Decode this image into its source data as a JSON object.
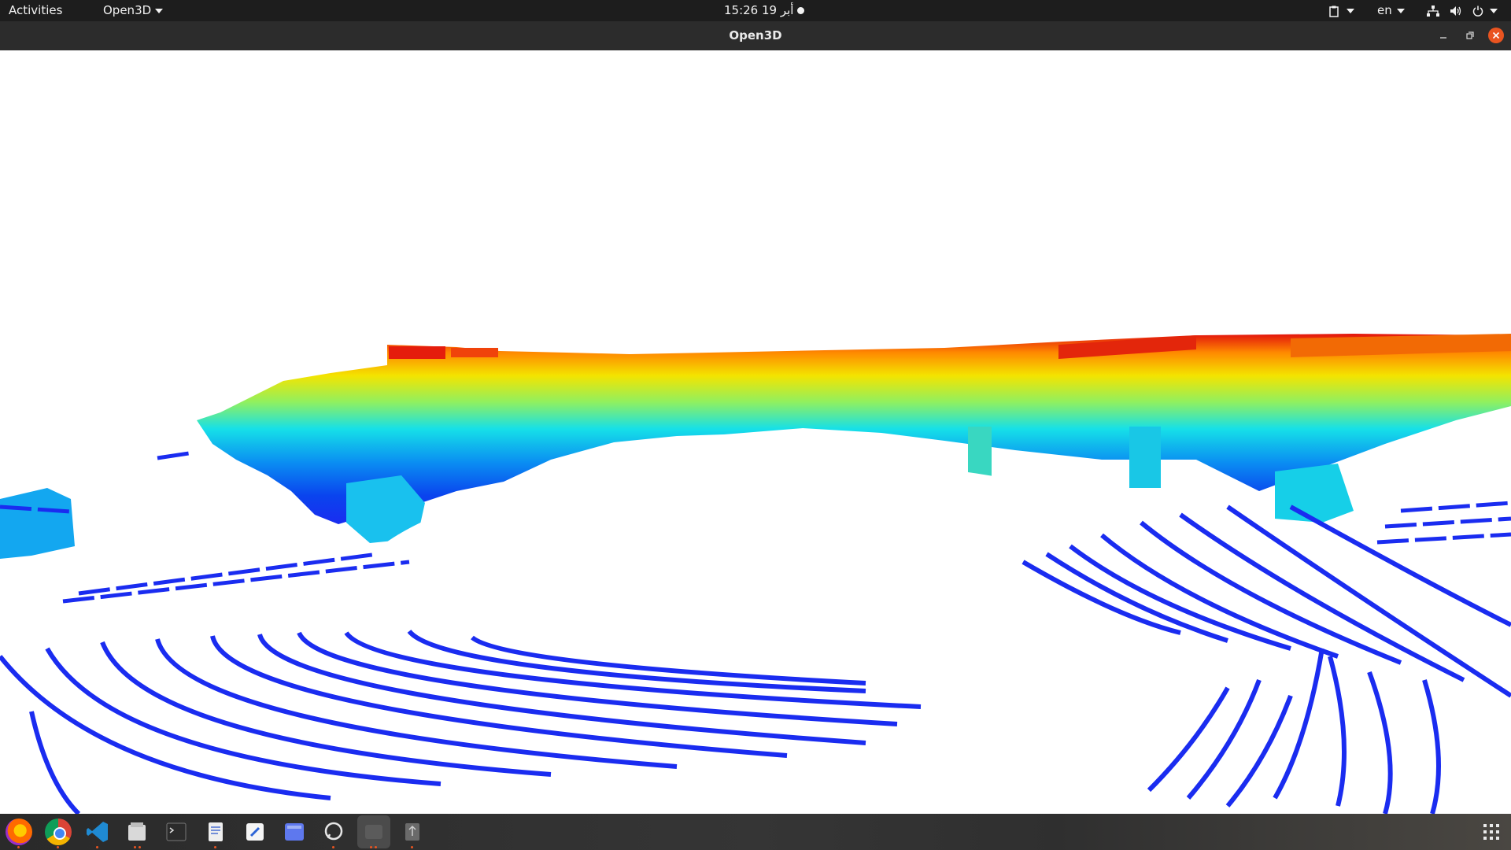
{
  "topbar": {
    "activities": "Activities",
    "app_menu": "Open3D",
    "clock": "15:26  19 أبر",
    "language": "en"
  },
  "window": {
    "title": "Open3D"
  },
  "dock": {
    "apps": [
      "firefox-icon",
      "chrome-icon",
      "vscode-icon",
      "files-icon",
      "terminal-icon",
      "text-editor-icon",
      "notes-icon",
      "screenshot-icon",
      "chat-icon",
      "open3d-app-icon",
      "usb-icon"
    ]
  },
  "colors": {
    "topbar": "#1d1d1d",
    "titlebar": "#2c2c2c",
    "close": "#e95420",
    "ground_points": "#1a2cf0"
  }
}
